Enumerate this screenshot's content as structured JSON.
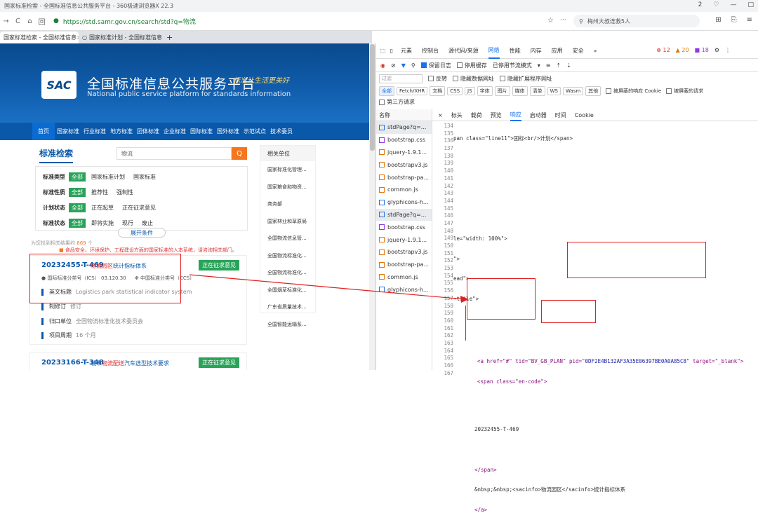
{
  "window": {
    "title": "国家标准检索 - 全国标准信息公共服务平台 - 360极速浏览器X 22.3",
    "controls": [
      "2",
      "♡",
      "—",
      "□"
    ]
  },
  "address": {
    "url": "https://std.samr.gov.cn/search/std?q=物流",
    "search_text": "梅州大叔连救5人",
    "nav": [
      "→",
      "C",
      "⌂",
      "回"
    ],
    "right_icons": [
      "☆",
      "···"
    ],
    "far_icons": [
      "⊞",
      "⎘",
      "≡"
    ]
  },
  "tabs": [
    {
      "label": "国家标准检索 - 全国标准信息"
    },
    {
      "label": "国家标准计划 - 全国标准信息"
    }
  ],
  "site": {
    "logo": "SAC",
    "title": "全国标准信息公共服务平台",
    "subtitle": "National public service platform  for standards information",
    "slogan": "标准让生活更美好",
    "nav": [
      "首页",
      "国家标准",
      "行业标准",
      "地方标准",
      "团体标准",
      "企业标准",
      "国际标准",
      "国外标准",
      "示范试点",
      "技术委员"
    ],
    "search_title": "标准检索",
    "search_value": "物流",
    "search_icon": "Q",
    "filters": [
      {
        "label": "标准类型",
        "all": "全部",
        "options": [
          "国家标准计划",
          "国家标准"
        ]
      },
      {
        "label": "标准性质",
        "all": "全部",
        "options": [
          "推荐性",
          "强制性"
        ]
      },
      {
        "label": "计划状态",
        "all": "全部",
        "options": [
          "正在起草",
          "正在征求意见"
        ]
      },
      {
        "label": "标准状态",
        "all": "全部",
        "options": [
          "即将实施",
          "现行",
          "废止"
        ]
      }
    ],
    "expand": "展开条件",
    "found_prefix": "为您找到相关结果约",
    "found_count": "669",
    "found_suffix": "个",
    "warning": "食品安全、环境保护、工程建设方面的国家标准的入本系统，请咨询相关部门。",
    "results": [
      {
        "id": "20232455-T-469",
        "name_hl": "物流园区",
        "name_rest": "统计指标体系",
        "status": "正在征求意见",
        "ics_label": "国际标准分类号（ICS）",
        "ics": "03.120.30",
        "ccs_label": "中国标准分类号（CCS）",
        "en_label": "英文标题",
        "en": "Logistics park statistical indicator system",
        "type_label": "制修订",
        "type": "修订",
        "org_label": "归口单位",
        "org": "全国物流标准化技术委员会",
        "period_label": "项目周期",
        "period": "16 个月"
      },
      {
        "id": "20233166-T-348",
        "name_pre": "城市",
        "name_hl": "物流配送",
        "name_rest": "汽车选型技术要求",
        "status": "正在征求意见"
      }
    ],
    "related_title": "相关单位",
    "related": [
      "国家标准化管理...",
      "国家粮食和物资...",
      "商务部",
      "国家林业和草原局",
      "全国物流信息管...",
      "全国物流标准化...",
      "全国物流标准化...",
      "全国烟草标准化...",
      "广东省质量技术...",
      "全国智能运输系..."
    ]
  },
  "devtools": {
    "tabs": [
      "元素",
      "控制台",
      "源代码/来源",
      "网络",
      "性能",
      "内存",
      "应用",
      "安全",
      "»"
    ],
    "active_tab": "网络",
    "errors": "⊗ 12",
    "warnings": "▲ 20",
    "info": "■ 18",
    "toolbar": {
      "preserve": "保留日志",
      "disable_cache": "停用缓存",
      "throttle": "已停用节流模式"
    },
    "filter_placeholder": "过滤",
    "invert": "反转",
    "hide_data": "隐藏数据网址",
    "hide_ext": "隐藏扩展程序网址",
    "types": [
      "全部",
      "Fetch/XHR",
      "文档",
      "CSS",
      "JS",
      "字体",
      "图片",
      "媒体",
      "清单",
      "WS",
      "Wasm",
      "其他"
    ],
    "blocked_cookies": "被屏蔽的响应 Cookie",
    "blocked_req": "被屏蔽的请求",
    "third_party": "第三方请求",
    "list_header": "名称",
    "files": [
      {
        "name": "stdPage?q=...",
        "kind": "doc"
      },
      {
        "name": "bootstrap.css",
        "kind": "css"
      },
      {
        "name": "jquery-1.9.1...",
        "kind": "js"
      },
      {
        "name": "bootstrapv3.js",
        "kind": "js"
      },
      {
        "name": "bootstrap-pa...",
        "kind": "js"
      },
      {
        "name": "common.js",
        "kind": "js"
      },
      {
        "name": "glyphicons-h...",
        "kind": "font"
      },
      {
        "name": "stdPage?q=...",
        "kind": "doc"
      },
      {
        "name": "bootstrap.css",
        "kind": "css"
      },
      {
        "name": "jquery-1.9.1...",
        "kind": "js"
      },
      {
        "name": "bootstrapv3.js",
        "kind": "js"
      },
      {
        "name": "bootstrap-pa...",
        "kind": "js"
      },
      {
        "name": "common.js",
        "kind": "js"
      },
      {
        "name": "glyphicons-h...",
        "kind": "font"
      }
    ],
    "resp_tabs": [
      "×",
      "标头",
      "载荷",
      "预览",
      "响应",
      "启动器",
      "时间",
      "Cookie"
    ],
    "resp_active": "响应",
    "line_numbers": [
      "134",
      "135",
      "136",
      "137",
      "138",
      "139",
      "140",
      "141",
      "142",
      "143",
      "144",
      "145",
      "146",
      "147",
      "148",
      "149",
      "150",
      "151",
      "152",
      "153",
      "154",
      "155",
      "156",
      "157",
      "158",
      "159",
      "160",
      "161",
      "162",
      "163",
      "164",
      "165",
      "166",
      "167"
    ],
    "code": {
      "l134": "pan class=\"line11\">国标<br/>计划</span>",
      "l144": "le=\"width: 100%\">",
      "l145": "\">",
      "l146": "ead\">",
      "l147": "-title\">",
      "l152a": "<a href=\"#\" tid=\"BV_GB_PLAN\" pid=\"",
      "pid": "0DF2E4B132AF3A35E06397BE0A0A85C8",
      "l152b": "\" target=\"_blank\">",
      "l153": "<span class=\"en-code\">",
      "l156": "20232455-T-469",
      "l158": "</span>",
      "l159a": "&nbsp;&nbsp;<sacinfo>",
      "l159b": "物流园区",
      "l159c": "</sacinfo>",
      "l159d": "统计指标体系",
      "l160": "</a>"
    }
  },
  "colors": {
    "brand": "#0a58aa",
    "green": "#2aa35a",
    "orange": "#f5761f",
    "highlight": "#e02020",
    "devtools_accent": "#1a73e8"
  }
}
